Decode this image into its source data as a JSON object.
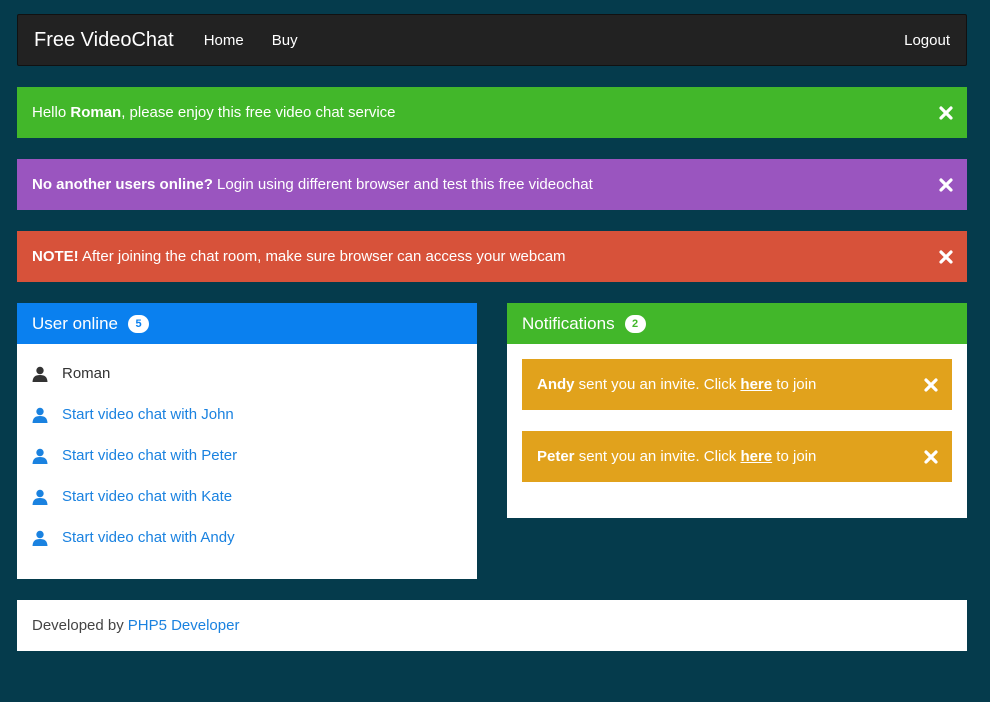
{
  "navbar": {
    "brand": "Free VideoChat",
    "links": [
      "Home",
      "Buy"
    ],
    "logout": "Logout"
  },
  "alerts": {
    "welcome": {
      "prefix": "Hello ",
      "name": "Roman",
      "suffix": ", please enjoy this free video chat service",
      "color": "#42b72a"
    },
    "info": {
      "strong": "No another users online?",
      "text": " Login using different browser and test this free videochat",
      "color": "#9a55bf"
    },
    "note": {
      "strong": "NOTE!",
      "text": " After joining the chat room, make sure browser can access your webcam",
      "color": "#d7523a"
    }
  },
  "users_panel": {
    "title": "User online",
    "count": "5",
    "current_user": "Roman",
    "links": [
      "Start video chat with John",
      "Start video chat with Peter",
      "Start video chat with Kate",
      "Start video chat with Andy"
    ],
    "header_color": "#0a80ef"
  },
  "notifications_panel": {
    "title": "Notifications",
    "count": "2",
    "header_color": "#42b72a",
    "items": [
      {
        "sender": "Andy",
        "text": " sent you an invite. Click ",
        "link": "here",
        "after": " to join"
      },
      {
        "sender": "Peter",
        "text": " sent you an invite. Click ",
        "link": "here",
        "after": " to join"
      }
    ],
    "item_color": "#e1a21c"
  },
  "footer": {
    "text": "Developed by",
    "link": "PHP5 Developer"
  },
  "icons": {
    "close": "close-icon",
    "user": "user-icon"
  }
}
